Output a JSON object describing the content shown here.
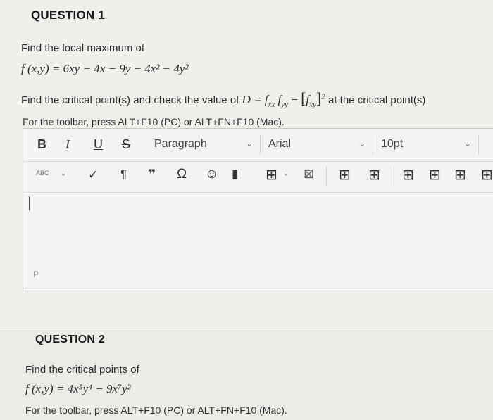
{
  "question1": {
    "title": "QUESTION 1",
    "prompt": "Find the local maximum of",
    "function_lhs": "f (x,y)",
    "function_rhs": "= 6xy − 4x − 9y − 4x² − 4y²",
    "critical_text": "Find the critical point(s) and check the value of",
    "discriminant": "D = f",
    "sub_xx": "xx",
    "f_yy": "f",
    "sub_yy": "yy",
    "minus": "−",
    "f_xy": "f",
    "sub_xy": "xy",
    "square": "2",
    "critical_suffix": "at the critical point(s)",
    "toolbar_hint": "For the toolbar, press ALT+F10 (PC) or ALT+FN+F10 (Mac)."
  },
  "editor": {
    "bold": "B",
    "italic": "I",
    "underline": "U",
    "strike": "S",
    "paragraph_select": "Paragraph",
    "font_select": "Arial",
    "size_select": "10pt",
    "status_path": "P"
  },
  "icons": {
    "spellcheck": "ABC",
    "paragraph_mark": "¶",
    "quote": "❞",
    "omega": "Ω",
    "emoji": "☺",
    "bookmark": "▮",
    "table": "⊞",
    "chevron": "⌄",
    "clear": "⊠"
  },
  "question2": {
    "title": "QUESTION 2",
    "prompt": "Find the critical points of",
    "function": "f (x,y) = 4x⁵y⁴ − 9x⁷y²",
    "toolbar_hint": "For the toolbar, press ALT+F10 (PC) or ALT+FN+F10 (Mac)."
  }
}
